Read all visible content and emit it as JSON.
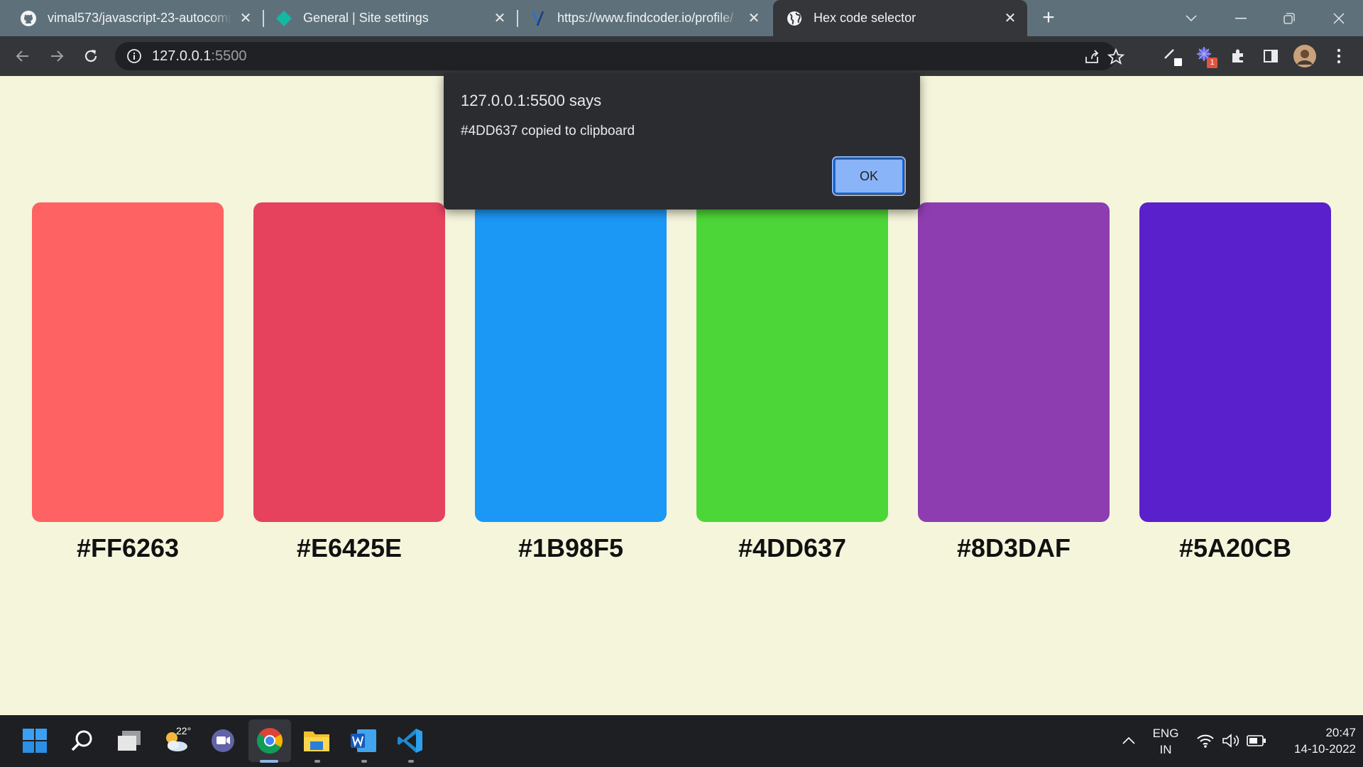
{
  "browser": {
    "tabs": [
      {
        "title": "vimal573/javascript-23-autocomplete",
        "icon": "github-icon",
        "active": false
      },
      {
        "title": "General | Site settings",
        "icon": "site-settings-icon",
        "active": false
      },
      {
        "title": "https://www.findcoder.io/profile/",
        "icon": "findcoder-icon",
        "active": false
      },
      {
        "title": "Hex code selector",
        "icon": "globe-icon",
        "active": true
      }
    ],
    "address": {
      "host": "127.0.0.1",
      "port": ":5500"
    },
    "extension_badge": "1"
  },
  "dialog": {
    "title": "127.0.0.1:5500 says",
    "message": "#4DD637 copied to clipboard",
    "ok_label": "OK"
  },
  "palette": [
    {
      "hex": "#FF6263"
    },
    {
      "hex": "#E6425E"
    },
    {
      "hex": "#1B98F5"
    },
    {
      "hex": "#4DD637"
    },
    {
      "hex": "#8D3DAF"
    },
    {
      "hex": "#5A20CB"
    }
  ],
  "taskbar": {
    "weather_temp": "22°",
    "language": "ENG",
    "region": "IN",
    "time": "20:47",
    "date": "14-10-2022"
  }
}
